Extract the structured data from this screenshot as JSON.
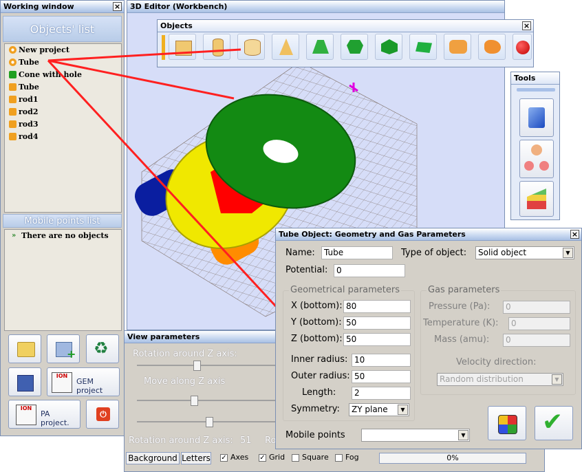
{
  "working_window": {
    "title": "Working window",
    "objects_header": "Objects' list",
    "objects": [
      {
        "label": "New project",
        "icon": "project-icon"
      },
      {
        "label": "Tube",
        "icon": "project-icon"
      },
      {
        "label": "Cone with hole",
        "icon": "green-object-icon"
      },
      {
        "label": "Tube",
        "icon": "orange-object-icon"
      },
      {
        "label": "rod1",
        "icon": "orange-object-icon"
      },
      {
        "label": "rod2",
        "icon": "orange-object-icon"
      },
      {
        "label": "rod3",
        "icon": "orange-object-icon"
      },
      {
        "label": "rod4",
        "icon": "orange-object-icon"
      }
    ],
    "mobile_header": "Mobile points list",
    "mobile_items": [
      "There are no objects"
    ],
    "buttons": {
      "gem_project": "GEM project",
      "pa_project": "PA project."
    }
  },
  "editor": {
    "title": "3D Editor (Workbench)",
    "objects_toolbar_title": "Objects",
    "tools_title": "Tools",
    "colors": {
      "green_disk": "#138a13",
      "yellow_disk": "#f0e800",
      "red_cone": "#ff0000",
      "blue_rod": "#0a1ea0",
      "orange_rod": "#ff8c00",
      "background": "#d6ddf8"
    }
  },
  "view_params": {
    "title": "View parameters",
    "rotation_label": "Rotation around Z axis:",
    "move_label": "Move along Z axis",
    "status_rotation": "Rotation around Z axis:",
    "status_rotation_value": "51",
    "status_truncated": "Ro",
    "tabs": [
      "Background",
      "Letters"
    ],
    "checkboxes": [
      {
        "label": "Axes",
        "checked": true
      },
      {
        "label": "Grid",
        "checked": true
      },
      {
        "label": "Square",
        "checked": false
      },
      {
        "label": "Fog",
        "checked": false
      }
    ],
    "progress_text": "0%",
    "progress": 0
  },
  "tube_dialog": {
    "title": "Tube Object: Geometry and Gas Parameters",
    "name_label": "Name:",
    "name_value": "Tube",
    "type_label": "Type of object:",
    "type_value": "Solid object",
    "potential_label": "Potential:",
    "potential_value": "0",
    "geom_group": "Geometrical parameters",
    "x_label": "X (bottom):",
    "x_value": "80",
    "y_label": "Y (bottom):",
    "y_value": "50",
    "z_label": "Z (bottom):",
    "z_value": "50",
    "inner_label": "Inner radius:",
    "inner_value": "10",
    "outer_label": "Outer radius:",
    "outer_value": "50",
    "length_label": "Length:",
    "length_value": "2",
    "symmetry_label": "Symmetry:",
    "symmetry_value": "ZY plane",
    "gas_group": "Gas parameters",
    "pressure_label": "Pressure (Pa):",
    "pressure_value": "0",
    "temperature_label": "Temperature (K):",
    "temperature_value": "0",
    "mass_label": "Mass (amu):",
    "mass_value": "0",
    "velocity_label": "Velocity direction:",
    "velocity_value": "Random distribution",
    "mobile_label": "Mobile points",
    "mobile_value": ""
  }
}
